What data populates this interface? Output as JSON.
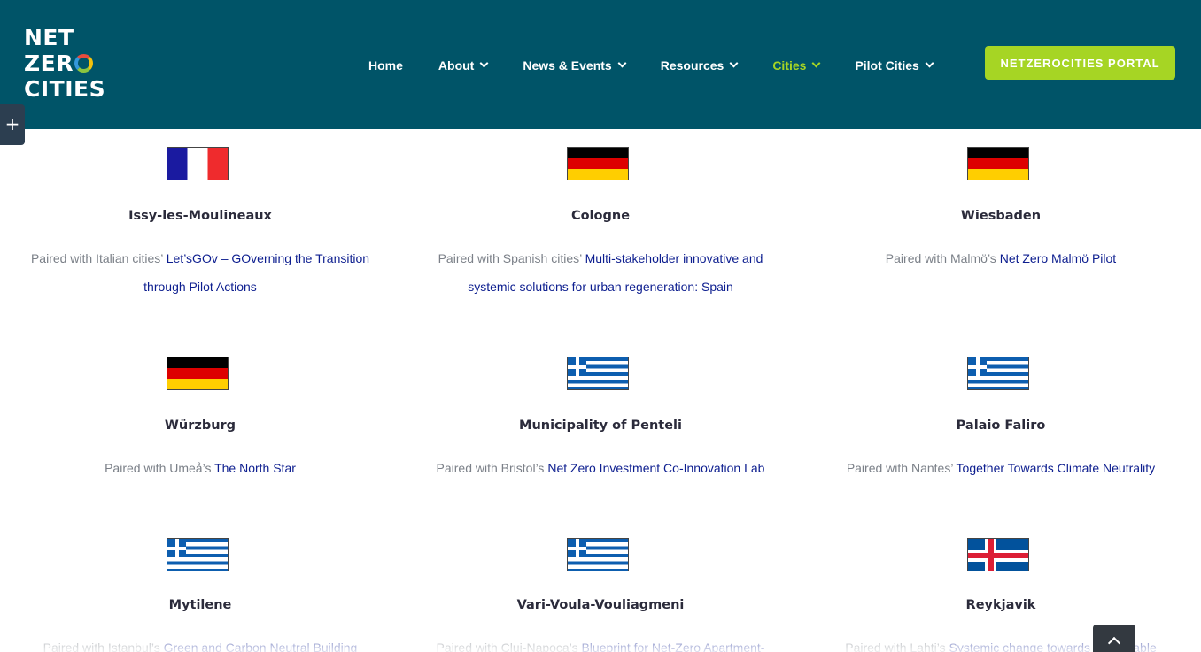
{
  "header": {
    "logo_lines": [
      "NET",
      "ZER",
      "CITIES"
    ],
    "nav": [
      {
        "label": "Home",
        "has_dropdown": false,
        "active": false
      },
      {
        "label": "About",
        "has_dropdown": true,
        "active": false
      },
      {
        "label": "News & Events",
        "has_dropdown": true,
        "active": false
      },
      {
        "label": "Resources",
        "has_dropdown": true,
        "active": false
      },
      {
        "label": "Cities",
        "has_dropdown": true,
        "active": true
      },
      {
        "label": "Pilot Cities",
        "has_dropdown": true,
        "active": false
      }
    ],
    "portal_button": "NETZEROCITIES PORTAL"
  },
  "side_toggle_label": "+",
  "colors": {
    "header_bg": "#005468",
    "accent_green": "#a6d524",
    "link_blue": "#0d1e8f",
    "muted_text": "#7b8088"
  },
  "cities": [
    {
      "flag": "france",
      "name": "Issy-les-Moulineaux",
      "prefix": "Paired with Italian cities’ ",
      "link": "Let’sGOv – GOverning the Transition through Pilot Actions"
    },
    {
      "flag": "germany",
      "name": "Cologne",
      "prefix": "Paired with Spanish cities’ ",
      "link": "Multi-stakeholder innovative and systemic solutions for urban regeneration: Spain"
    },
    {
      "flag": "germany",
      "name": "Wiesbaden",
      "prefix": "Paired with Malmö’s ",
      "link": "Net Zero Malmö Pilot"
    },
    {
      "flag": "germany",
      "name": "Würzburg",
      "prefix": "Paired with Umeå’s ",
      "link": "The North Star"
    },
    {
      "flag": "greece",
      "name": "Municipality of Penteli",
      "prefix": "Paired with Bristol’s ",
      "link": "Net Zero Investment Co-Innovation Lab"
    },
    {
      "flag": "greece",
      "name": "Palaio Faliro",
      "prefix": "Paired with Nantes’ ",
      "link": "Together Towards Climate Neutrality"
    },
    {
      "flag": "greece",
      "name": "Mytilene",
      "prefix": "Paired with Istanbul’s ",
      "link": "Green and Carbon Neutral Building"
    },
    {
      "flag": "greece",
      "name": "Vari-Voula-Vouliagmeni",
      "prefix": "Paired with Cluj-Napoca’s ",
      "link": "Blueprint for Net-Zero Apartment-"
    },
    {
      "flag": "iceland",
      "name": "Reykjavik",
      "prefix": "Paired with Lahti’s ",
      "link": "Systemic change towards sustainable"
    }
  ]
}
